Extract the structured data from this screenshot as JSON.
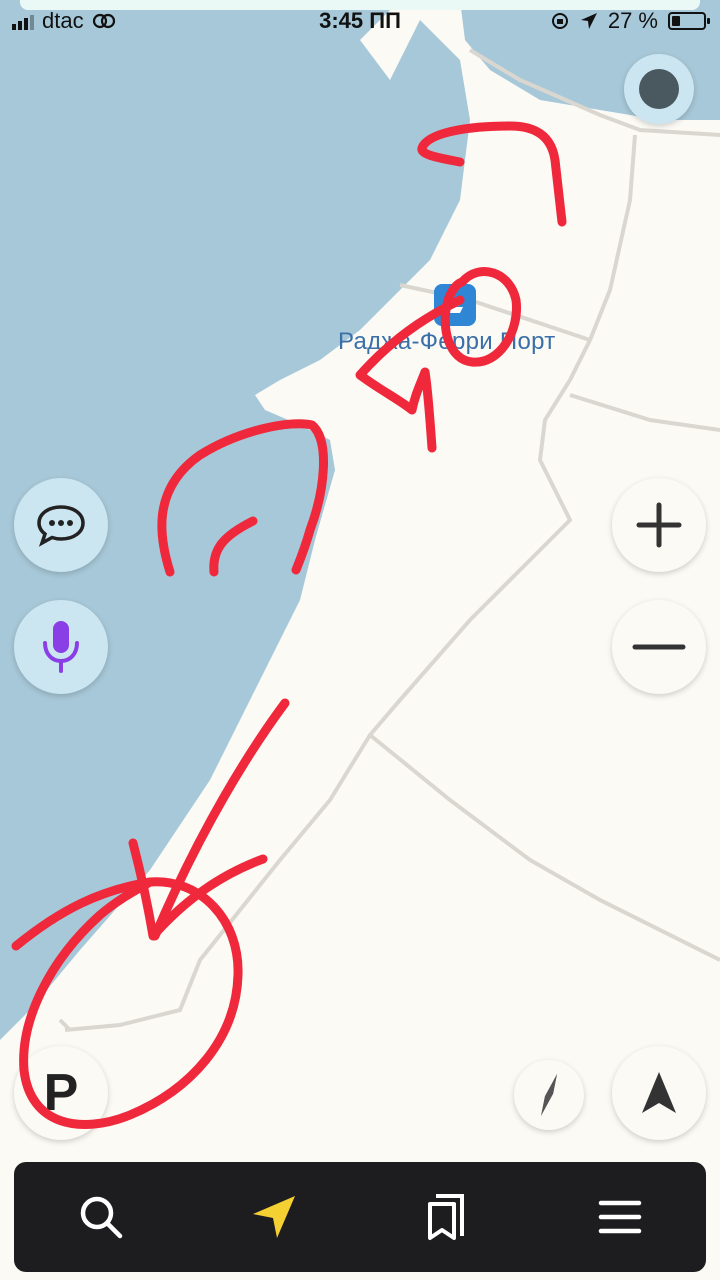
{
  "status_bar": {
    "carrier": "dtac",
    "time": "3:45 ПП",
    "battery": "27 %",
    "battery_level": 0.27
  },
  "map": {
    "poi": {
      "label": "Раджа-Ферри Порт",
      "icon": "ferry-icon"
    }
  },
  "controls": {
    "layers_icon": "layers-icon",
    "chat_icon": "chat-icon",
    "voice_icon": "microphone-icon",
    "zoom_in_icon": "plus-icon",
    "zoom_out_icon": "minus-icon",
    "compass_icon": "compass-icon",
    "location_icon": "navigation-arrow-icon",
    "parking": {
      "icon": "parking-icon",
      "label": "P"
    }
  },
  "bottom_nav": [
    {
      "name": "search",
      "icon": "search-icon"
    },
    {
      "name": "navigation",
      "icon": "navigation-icon",
      "color": "#f5d033"
    },
    {
      "name": "bookmarks",
      "icon": "bookmarks-icon"
    },
    {
      "name": "menu",
      "icon": "menu-icon"
    }
  ],
  "colors": {
    "water": "#a7c8d8",
    "land": "#fbfaf5",
    "road": "#d8d6cf",
    "annotation": "#f0283c",
    "voice_accent": "#8a3ee6",
    "poi_blue": "#2f86d4"
  }
}
